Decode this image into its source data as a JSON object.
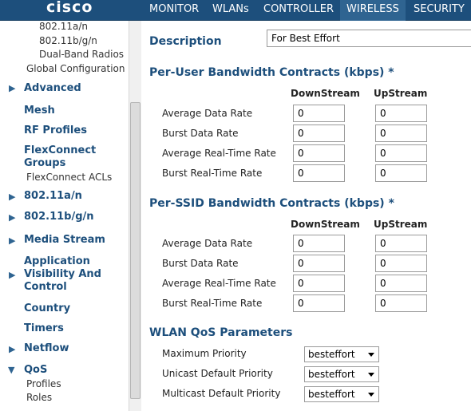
{
  "header": {
    "logo": "cisco",
    "tabs": [
      "MONITOR",
      "WLANs",
      "CONTROLLER",
      "WIRELESS",
      "SECURITY"
    ],
    "active_tab": "WIRELESS",
    "accent_color": "#ff9900",
    "bar_color": "#1d4f7c"
  },
  "sidebar": {
    "top_items": [
      "802.11a/n",
      "802.11b/g/n",
      "Dual-Band Radios",
      "Global Configuration"
    ],
    "advanced": "Advanced",
    "mesh": "Mesh",
    "rf_profiles": "RF Profiles",
    "flexconnect_groups": "FlexConnect\nGroups",
    "flexconnect_groups_line1": "FlexConnect",
    "flexconnect_groups_line2": "Groups",
    "flexconnect_acls": "FlexConnect ACLs",
    "a_n": "802.11a/n",
    "b_g_n": "802.11b/g/n",
    "media_stream": "Media Stream",
    "avc_line1": "Application",
    "avc_line2": "Visibility And",
    "avc_line3": "Control",
    "country": "Country",
    "timers": "Timers",
    "netflow": "Netflow",
    "qos": "QoS",
    "profiles": "Profiles",
    "roles": "Roles"
  },
  "main": {
    "description_label": "Description",
    "description_value": "For Best Effort",
    "per_user_title": "Per-User Bandwidth Contracts (kbps) *",
    "per_ssid_title": "Per-SSID Bandwidth Contracts (kbps) *",
    "col_down": "DownStream",
    "col_up": "UpStream",
    "rows": [
      "Average Data Rate",
      "Burst Data Rate",
      "Average Real-Time Rate",
      "Burst Real-Time Rate"
    ],
    "per_user_values": [
      [
        "0",
        "0"
      ],
      [
        "0",
        "0"
      ],
      [
        "0",
        "0"
      ],
      [
        "0",
        "0"
      ]
    ],
    "per_ssid_values": [
      [
        "0",
        "0"
      ],
      [
        "0",
        "0"
      ],
      [
        "0",
        "0"
      ],
      [
        "0",
        "0"
      ]
    ],
    "qos_title": "WLAN QoS Parameters",
    "qos_rows": [
      "Maximum Priority",
      "Unicast Default Priority",
      "Multicast Default Priority"
    ],
    "qos_values": [
      "besteffort",
      "besteffort",
      "besteffort"
    ]
  }
}
